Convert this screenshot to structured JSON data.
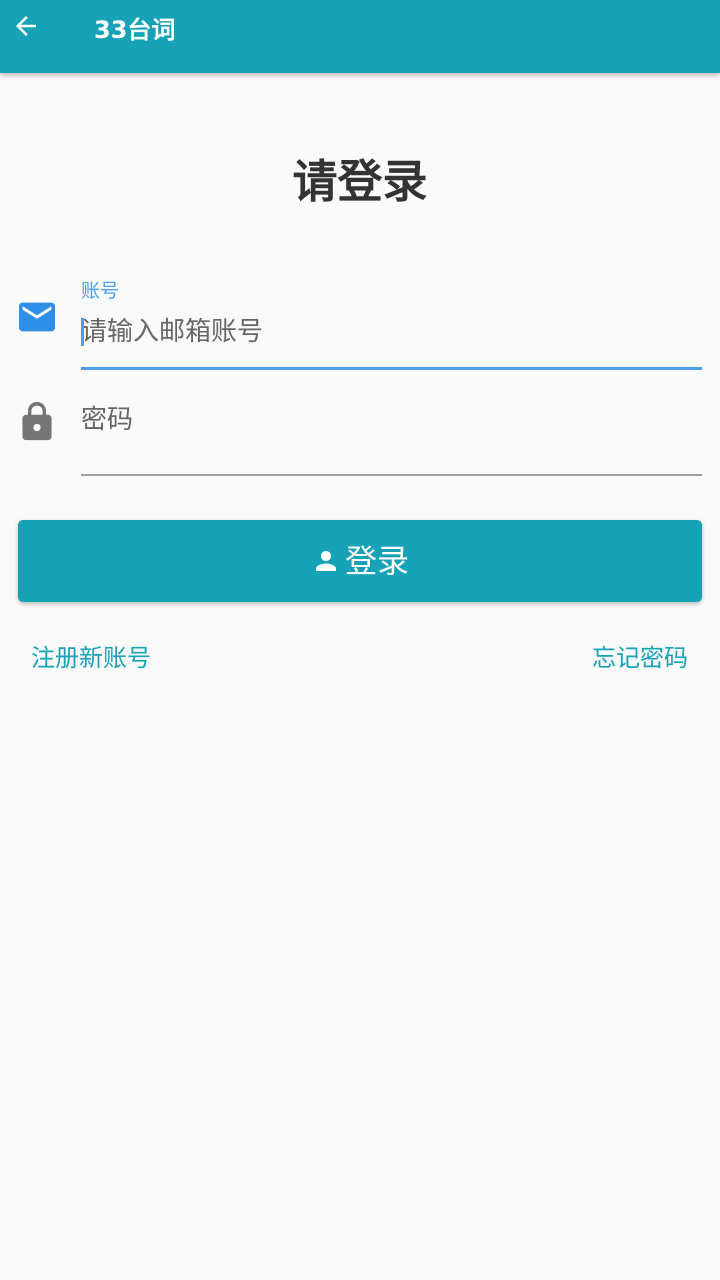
{
  "app_bar": {
    "title": "33台词",
    "back_icon": "arrow-back-icon",
    "background_color": "#17a2b8"
  },
  "login": {
    "heading": "请登录",
    "account": {
      "label": "账号",
      "placeholder": "请输入邮箱账号",
      "value": "",
      "icon": "email-icon",
      "focused": true
    },
    "password": {
      "placeholder": "密码",
      "value": "",
      "icon": "lock-icon"
    },
    "submit": {
      "label": "登录",
      "icon": "person-icon"
    },
    "links": {
      "register": "注册新账号",
      "forgot_password": "忘记密码"
    }
  },
  "colors": {
    "primary": "#17a2b8",
    "focus": "#4a9eea",
    "background": "#fafafa"
  }
}
